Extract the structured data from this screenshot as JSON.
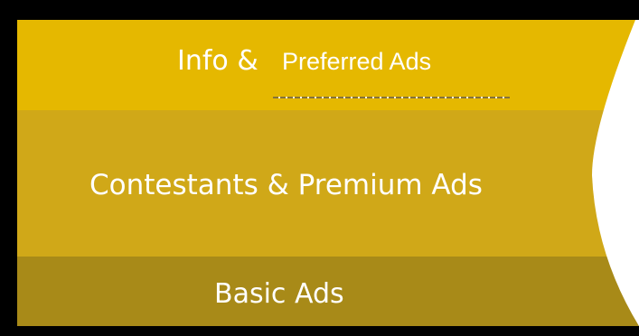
{
  "tiers": [
    {
      "label_prefix": "Info &",
      "label": "Preferred Ads"
    },
    {
      "label": "Contestants & Premium Ads"
    },
    {
      "label": "Basic Ads"
    }
  ],
  "colors": {
    "frame": "#000000",
    "tier_top": "#e5b800",
    "tier_middle": "#d0a818",
    "tier_bottom": "#a88a18",
    "text": "#ffffff",
    "curve_fill": "#ffffff"
  }
}
